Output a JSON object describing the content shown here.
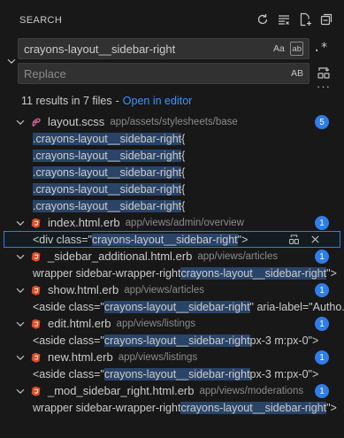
{
  "header": {
    "title": "SEARCH",
    "toolbar": [
      {
        "name": "refresh-icon"
      },
      {
        "name": "clear-results-icon"
      },
      {
        "name": "new-search-editor-icon"
      },
      {
        "name": "collapse-all-icon"
      }
    ]
  },
  "search": {
    "value": "crayons-layout__sidebar-right",
    "options": {
      "match_case": "Aa",
      "whole_word": "ab",
      "regex": ".*"
    }
  },
  "replace": {
    "placeholder": "Replace",
    "preserve_case": "AB"
  },
  "summary": {
    "count_text": "11 results in 7 files",
    "separator": "-",
    "link_text": "Open in editor"
  },
  "accent_color": "#2e7de9",
  "results": [
    {
      "filename": "layout.scss",
      "path": "app/assets/stylesheets/base",
      "icon": "sass-file-icon",
      "count": "5",
      "matches": [
        {
          "before": "",
          "match": ".crayons-layout__sidebar-right",
          "after": " {"
        },
        {
          "before": "",
          "match": ".crayons-layout__sidebar-right",
          "after": " {"
        },
        {
          "before": "",
          "match": ".crayons-layout__sidebar-right",
          "after": " {"
        },
        {
          "before": "",
          "match": ".crayons-layout__sidebar-right",
          "after": " {"
        },
        {
          "before": "",
          "match": ".crayons-layout__sidebar-right",
          "after": " {"
        }
      ]
    },
    {
      "filename": "index.html.erb",
      "path": "app/views/admin/overview",
      "icon": "erb-file-icon",
      "count": "1",
      "matches": [
        {
          "before": "<div class=\"",
          "match": "crayons-layout__sidebar-right",
          "after": "\">",
          "selected": true
        }
      ]
    },
    {
      "filename": "_sidebar_additional.html.erb",
      "path": "app/views/articles",
      "icon": "erb-file-icon",
      "count": "1",
      "matches": [
        {
          "before": "wrapper sidebar-wrapper-right ",
          "match": "crayons-layout__sidebar-right",
          "after": "\">"
        }
      ]
    },
    {
      "filename": "show.html.erb",
      "path": "app/views/articles",
      "icon": "erb-file-icon",
      "count": "1",
      "matches": [
        {
          "before": "<aside class=\"",
          "match": "crayons-layout__sidebar-right",
          "after": "\" aria-label=\"Autho..."
        }
      ]
    },
    {
      "filename": "edit.html.erb",
      "path": "app/views/listings",
      "icon": "erb-file-icon",
      "count": "1",
      "matches": [
        {
          "before": "<aside class=\"",
          "match": "crayons-layout__sidebar-right",
          "after": " px-3 m:px-0\">"
        }
      ]
    },
    {
      "filename": "new.html.erb",
      "path": "app/views/listings",
      "icon": "erb-file-icon",
      "count": "1",
      "matches": [
        {
          "before": "<aside class=\"",
          "match": "crayons-layout__sidebar-right",
          "after": " px-3 m:px-0\">"
        }
      ]
    },
    {
      "filename": "_mod_sidebar_right.html.erb",
      "path": "app/views/moderations",
      "icon": "erb-file-icon",
      "count": "1",
      "matches": [
        {
          "before": "wrapper sidebar-wrapper-right ",
          "match": "crayons-layout__sidebar-right",
          "after": "\">"
        }
      ]
    }
  ]
}
